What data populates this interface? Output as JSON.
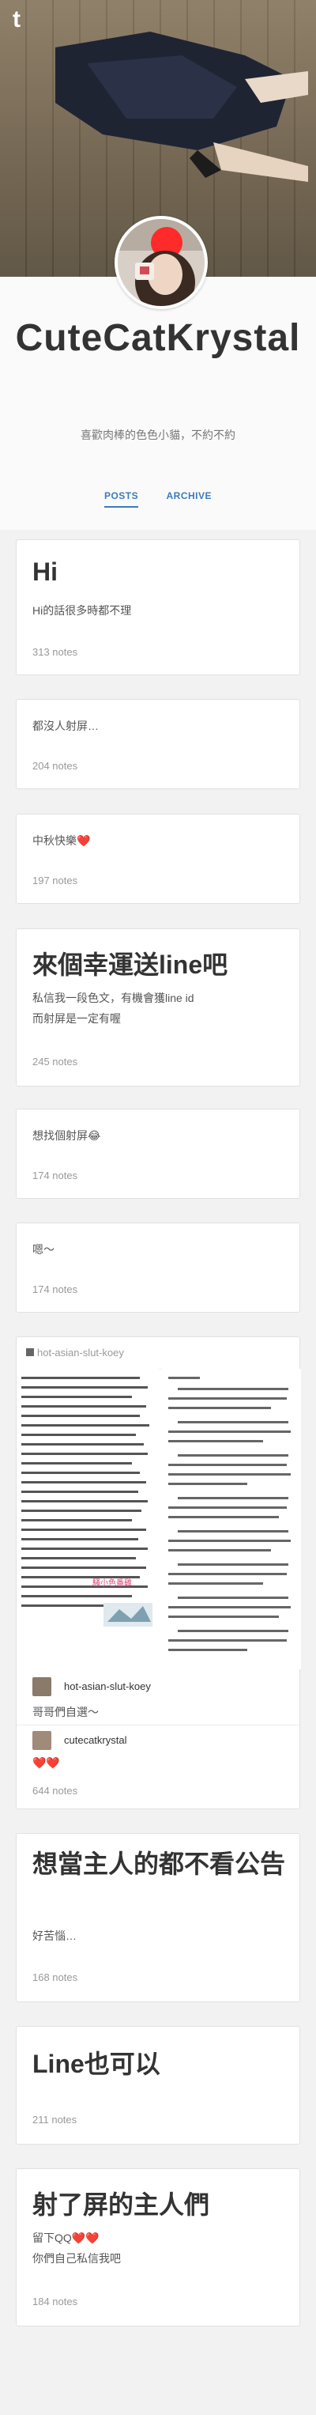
{
  "header": {
    "logo": "t"
  },
  "profile": {
    "title": "CuteCatKrystal",
    "description": "喜歡肉棒的色色小貓，不約不約",
    "nav": {
      "posts": "POSTS",
      "archive": "ARCHIVE"
    }
  },
  "posts": [
    {
      "title": "Hi",
      "body": "Hi的話很多時都不理",
      "notes": "313 notes"
    },
    {
      "body": "都沒人射屏…",
      "notes": "204 notes"
    },
    {
      "body": "中秋快樂❤️",
      "notes": "197 notes"
    },
    {
      "title": "來個幸運送line吧",
      "body1": "私信我一段色文，有機會獲line id",
      "body2": "而射屏是一定有喔",
      "notes": "245 notes"
    },
    {
      "body": "想找個射屏😂",
      "notes": "174 notes"
    },
    {
      "body": "嗯～",
      "notes": "174 notes"
    },
    {
      "reblog_user": "hot-asian-slut-koey",
      "watermark": "騷小色番雞",
      "reblog1_user": "hot-asian-slut-koey",
      "reblog1_text": "哥哥們自選～",
      "reblog2_user": "cutecatkrystal",
      "reblog2_text": "❤️❤️",
      "notes": "644 notes"
    },
    {
      "title": "想當主人的都不看公告",
      "body": "好苦惱…",
      "notes": "168 notes"
    },
    {
      "title": "Line也可以",
      "notes": "211 notes"
    },
    {
      "title": "射了屏的主人們",
      "body1": "留下QQ❤️❤️",
      "body2": "你們自己私信我吧",
      "notes": "184 notes"
    }
  ],
  "colors": {
    "link": "#3a7bbf",
    "background": "#f2f2f2",
    "card": "#ffffff"
  }
}
